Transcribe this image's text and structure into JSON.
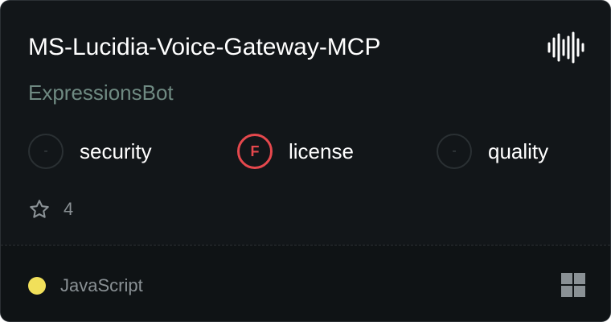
{
  "card": {
    "title": "MS-Lucidia-Voice-Gateway-MCP",
    "title_icon": "audio-waveform-icon",
    "author": "ExpressionsBot",
    "scores": [
      {
        "grade": "-",
        "label": "security",
        "status": "none"
      },
      {
        "grade": "F",
        "label": "license",
        "status": "fail"
      },
      {
        "grade": "-",
        "label": "quality",
        "status": "none"
      }
    ],
    "stars": "4",
    "star_icon": "star-icon",
    "language": "JavaScript",
    "language_color": "#f1e05a",
    "platform_icon": "windows-grid-icon"
  },
  "colors": {
    "background": "#121619",
    "fail": "#e5484d",
    "author": "#6f8a82"
  }
}
